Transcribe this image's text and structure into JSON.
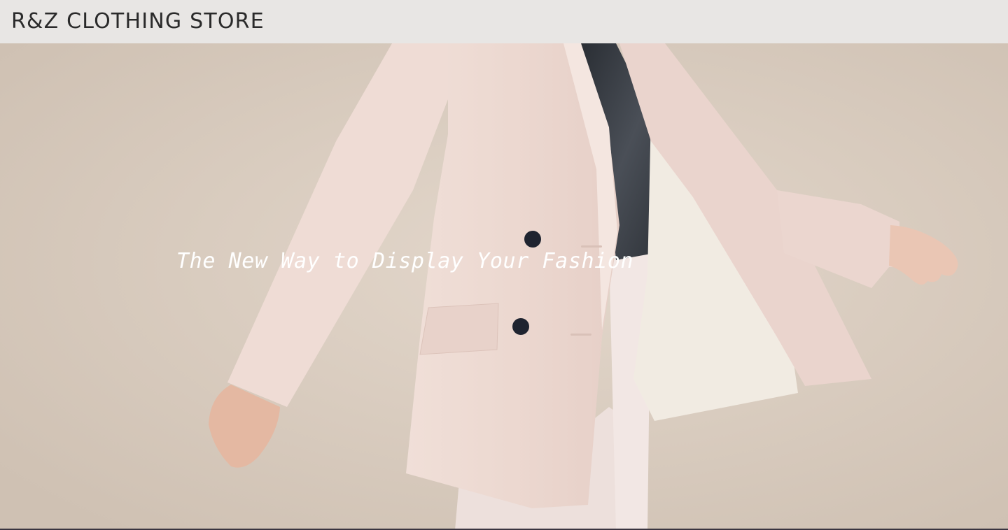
{
  "header": {
    "brand": "R&Z CLOTHING STORE"
  },
  "hero": {
    "tagline": "The New Way to Display Your Fashion",
    "image": "fashion-model-blazer-photo"
  },
  "colors": {
    "header_bg": "#e8e6e4",
    "backdrop": "#dccfc2",
    "blazer": "#ecd9d2",
    "camisole": "#33373d",
    "tagline_text": "#ffffff"
  }
}
